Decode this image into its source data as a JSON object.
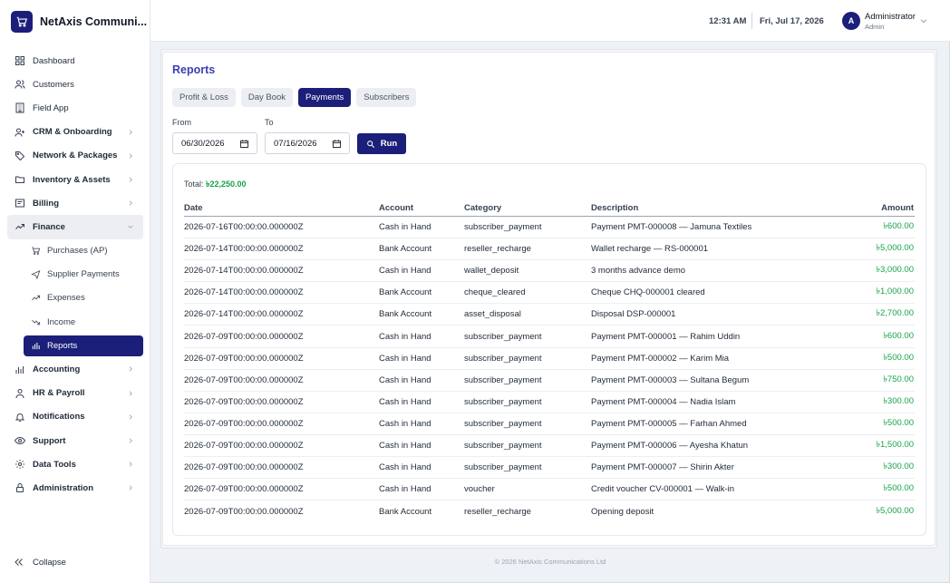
{
  "app": {
    "name": "NetAxis Communi..."
  },
  "header": {
    "time": "12:31 AM",
    "date": "Fri, Jul 17, 2026",
    "avatar_initial": "A",
    "user_name": "Administrator",
    "user_role": "Admin"
  },
  "sidebar": {
    "items": [
      {
        "label": "Dashboard",
        "icon": "grid-icon"
      },
      {
        "label": "Customers",
        "icon": "users-icon"
      },
      {
        "label": "Field App",
        "icon": "building-icon"
      },
      {
        "label": "CRM & Onboarding",
        "icon": "user-plus-icon"
      },
      {
        "label": "Network & Packages",
        "icon": "tag-icon"
      },
      {
        "label": "Inventory & Assets",
        "icon": "folder-icon"
      },
      {
        "label": "Billing",
        "icon": "receipt-icon"
      },
      {
        "label": "Finance",
        "icon": "trending-icon"
      },
      {
        "label": "Accounting",
        "icon": "bar-chart-icon"
      },
      {
        "label": "HR & Payroll",
        "icon": "person-icon"
      },
      {
        "label": "Notifications",
        "icon": "bell-icon"
      },
      {
        "label": "Support",
        "icon": "eye-icon"
      },
      {
        "label": "Data Tools",
        "icon": "gear-icon"
      },
      {
        "label": "Administration",
        "icon": "lock-icon"
      }
    ],
    "finance_sub": [
      {
        "label": "Purchases (AP)"
      },
      {
        "label": "Supplier Payments"
      },
      {
        "label": "Expenses"
      },
      {
        "label": "Income"
      },
      {
        "label": "Reports"
      }
    ],
    "collapse_label": "Collapse"
  },
  "page": {
    "title": "Reports",
    "tabs": [
      "Profit & Loss",
      "Day Book",
      "Payments",
      "Subscribers"
    ],
    "active_tab": "Payments",
    "from_label": "From",
    "to_label": "To",
    "from_value": "06/30/2026",
    "to_value": "07/16/2026",
    "run_label": "Run",
    "total_label": "Total:",
    "total_value": "৳22,250.00"
  },
  "table": {
    "headers": {
      "date": "Date",
      "account": "Account",
      "category": "Category",
      "description": "Description",
      "amount": "Amount"
    },
    "rows": [
      {
        "date": "2026-07-16T00:00:00.000000Z",
        "account": "Cash in Hand",
        "category": "subscriber_payment",
        "description": "Payment PMT-000008 — Jamuna Textiles",
        "amount": "৳600.00"
      },
      {
        "date": "2026-07-14T00:00:00.000000Z",
        "account": "Bank Account",
        "category": "reseller_recharge",
        "description": "Wallet recharge — RS-000001",
        "amount": "৳5,000.00"
      },
      {
        "date": "2026-07-14T00:00:00.000000Z",
        "account": "Cash in Hand",
        "category": "wallet_deposit",
        "description": "3 months advance demo",
        "amount": "৳3,000.00"
      },
      {
        "date": "2026-07-14T00:00:00.000000Z",
        "account": "Bank Account",
        "category": "cheque_cleared",
        "description": "Cheque CHQ-000001 cleared",
        "amount": "৳1,000.00"
      },
      {
        "date": "2026-07-14T00:00:00.000000Z",
        "account": "Bank Account",
        "category": "asset_disposal",
        "description": "Disposal DSP-000001",
        "amount": "৳2,700.00"
      },
      {
        "date": "2026-07-09T00:00:00.000000Z",
        "account": "Cash in Hand",
        "category": "subscriber_payment",
        "description": "Payment PMT-000001 — Rahim Uddin",
        "amount": "৳600.00"
      },
      {
        "date": "2026-07-09T00:00:00.000000Z",
        "account": "Cash in Hand",
        "category": "subscriber_payment",
        "description": "Payment PMT-000002 — Karim Mia",
        "amount": "৳500.00"
      },
      {
        "date": "2026-07-09T00:00:00.000000Z",
        "account": "Cash in Hand",
        "category": "subscriber_payment",
        "description": "Payment PMT-000003 — Sultana Begum",
        "amount": "৳750.00"
      },
      {
        "date": "2026-07-09T00:00:00.000000Z",
        "account": "Cash in Hand",
        "category": "subscriber_payment",
        "description": "Payment PMT-000004 — Nadia Islam",
        "amount": "৳300.00"
      },
      {
        "date": "2026-07-09T00:00:00.000000Z",
        "account": "Cash in Hand",
        "category": "subscriber_payment",
        "description": "Payment PMT-000005 — Farhan Ahmed",
        "amount": "৳500.00"
      },
      {
        "date": "2026-07-09T00:00:00.000000Z",
        "account": "Cash in Hand",
        "category": "subscriber_payment",
        "description": "Payment PMT-000006 — Ayesha Khatun",
        "amount": "৳1,500.00"
      },
      {
        "date": "2026-07-09T00:00:00.000000Z",
        "account": "Cash in Hand",
        "category": "subscriber_payment",
        "description": "Payment PMT-000007 — Shirin Akter",
        "amount": "৳300.00"
      },
      {
        "date": "2026-07-09T00:00:00.000000Z",
        "account": "Cash in Hand",
        "category": "voucher",
        "description": "Credit voucher CV-000001 — Walk-in",
        "amount": "৳500.00"
      },
      {
        "date": "2026-07-09T00:00:00.000000Z",
        "account": "Bank Account",
        "category": "reseller_recharge",
        "description": "Opening deposit",
        "amount": "৳5,000.00"
      }
    ]
  },
  "footer": {
    "text": "© 2026 NetAxis Communications Ltd"
  },
  "colors": {
    "brand": "#1b1f7a",
    "title": "#3b3fb0",
    "amount": "#16a34a"
  }
}
